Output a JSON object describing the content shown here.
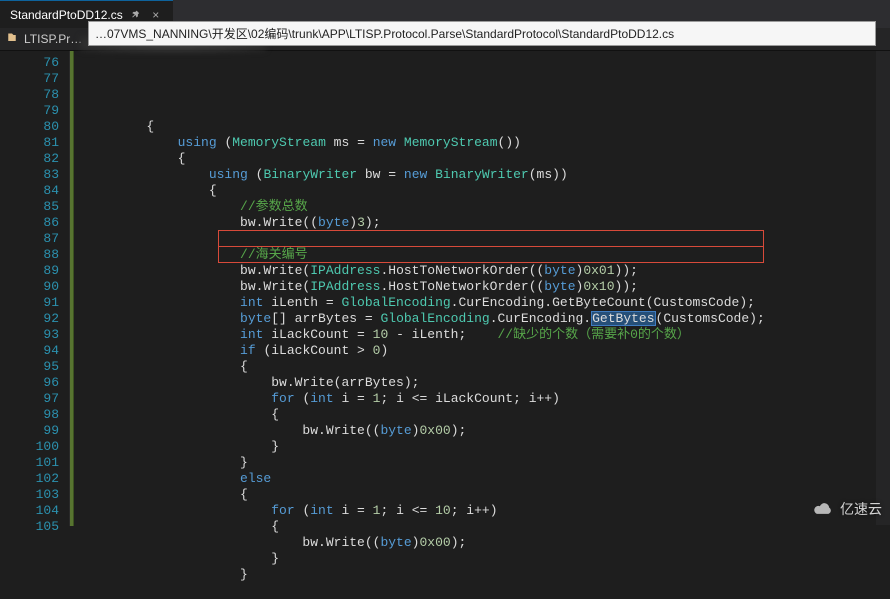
{
  "tab": {
    "filename": "StandardPtoDD12.cs",
    "pin": "📌",
    "close": "×"
  },
  "breadcrumb": {
    "ns": "LTISP.Pr…"
  },
  "tooltip": {
    "path": "…07VMS_NANNING\\开发区\\02编码\\trunk\\APP\\LTISP.Protocol.Parse\\StandardProtocol\\StandardPtoDD12.cs"
  },
  "gutter": {
    "start": 76,
    "end": 105
  },
  "code": {
    "lines": [
      {
        "i": 76,
        "t": "        {"
      },
      {
        "i": 77,
        "t": "            using (MemoryStream ms = new MemoryStream())"
      },
      {
        "i": 78,
        "t": "            {"
      },
      {
        "i": 79,
        "t": "                using (BinaryWriter bw = new BinaryWriter(ms))"
      },
      {
        "i": 80,
        "t": "                {"
      },
      {
        "i": 81,
        "t": "                    //参数总数"
      },
      {
        "i": 82,
        "t": "                    bw.Write((byte)3);"
      },
      {
        "i": 83,
        "t": ""
      },
      {
        "i": 84,
        "t": "                    //海关编号"
      },
      {
        "i": 85,
        "t": "                    bw.Write(IPAddress.HostToNetworkOrder((byte)0x01));"
      },
      {
        "i": 86,
        "t": "                    bw.Write(IPAddress.HostToNetworkOrder((byte)0x10));"
      },
      {
        "i": 87,
        "t": "                    int iLenth = GlobalEncoding.CurEncoding.GetByteCount(CustomsCode);"
      },
      {
        "i": 88,
        "t": "                    byte[] arrBytes = GlobalEncoding.CurEncoding.GetBytes(CustomsCode);"
      },
      {
        "i": 89,
        "t": "                    int iLackCount = 10 - iLenth;    //缺少的个数（需要补0的个数）"
      },
      {
        "i": 90,
        "t": "                    if (iLackCount > 0)"
      },
      {
        "i": 91,
        "t": "                    {"
      },
      {
        "i": 92,
        "t": "                        bw.Write(arrBytes);"
      },
      {
        "i": 93,
        "t": "                        for (int i = 1; i <= iLackCount; i++)"
      },
      {
        "i": 94,
        "t": "                        {"
      },
      {
        "i": 95,
        "t": "                            bw.Write((byte)0x00);"
      },
      {
        "i": 96,
        "t": "                        }"
      },
      {
        "i": 97,
        "t": "                    }"
      },
      {
        "i": 98,
        "t": "                    else"
      },
      {
        "i": 99,
        "t": "                    {"
      },
      {
        "i": 100,
        "t": "                        for (int i = 1; i <= 10; i++)"
      },
      {
        "i": 101,
        "t": "                        {"
      },
      {
        "i": 102,
        "t": "                            bw.Write((byte)0x00);"
      },
      {
        "i": 103,
        "t": "                        }"
      },
      {
        "i": 104,
        "t": "                    }"
      },
      {
        "i": 105,
        "t": ""
      }
    ]
  },
  "selection": {
    "line": 88,
    "token": "GetBytes"
  },
  "highlight_box": {
    "lines": [
      87,
      88
    ]
  },
  "watermark": {
    "text": "亿速云"
  }
}
